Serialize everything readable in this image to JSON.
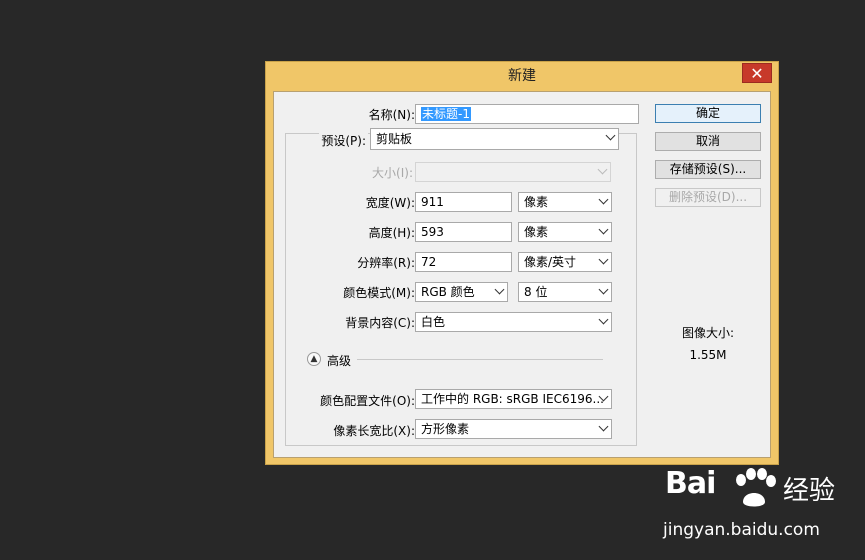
{
  "dialog": {
    "title": "新建",
    "close_label": "✕",
    "name_label": "名称(N):",
    "name_value": "未标题-1",
    "preset_label": "预设(P):",
    "preset_value": "剪贴板",
    "size_label": "大小(I):",
    "size_value": "",
    "width_label": "宽度(W):",
    "width_value": "911",
    "width_unit": "像素",
    "height_label": "高度(H):",
    "height_value": "593",
    "height_unit": "像素",
    "resolution_label": "分辨率(R):",
    "resolution_value": "72",
    "resolution_unit": "像素/英寸",
    "color_mode_label": "颜色模式(M):",
    "color_mode_value": "RGB 颜色",
    "bit_depth_value": "8 位",
    "background_label": "背景内容(C):",
    "background_value": "白色",
    "advanced_label": "高级",
    "color_profile_label": "颜色配置文件(O):",
    "color_profile_value": "工作中的 RGB: sRGB IEC6196...",
    "pixel_aspect_label": "像素长宽比(X):",
    "pixel_aspect_value": "方形像素",
    "buttons": {
      "ok": "确定",
      "cancel": "取消",
      "save_preset": "存储预设(S)...",
      "delete_preset": "删除预设(D)..."
    },
    "image_size_label": "图像大小:",
    "image_size_value": "1.55M"
  },
  "watermark": {
    "logo_text": "Bai",
    "brand_text": "经验",
    "url": "jingyan.baidu.com"
  },
  "colors": {
    "background": "#282828",
    "dialog_frame": "#f0c668",
    "close_button": "#c7392a",
    "selection": "#3399ff"
  }
}
